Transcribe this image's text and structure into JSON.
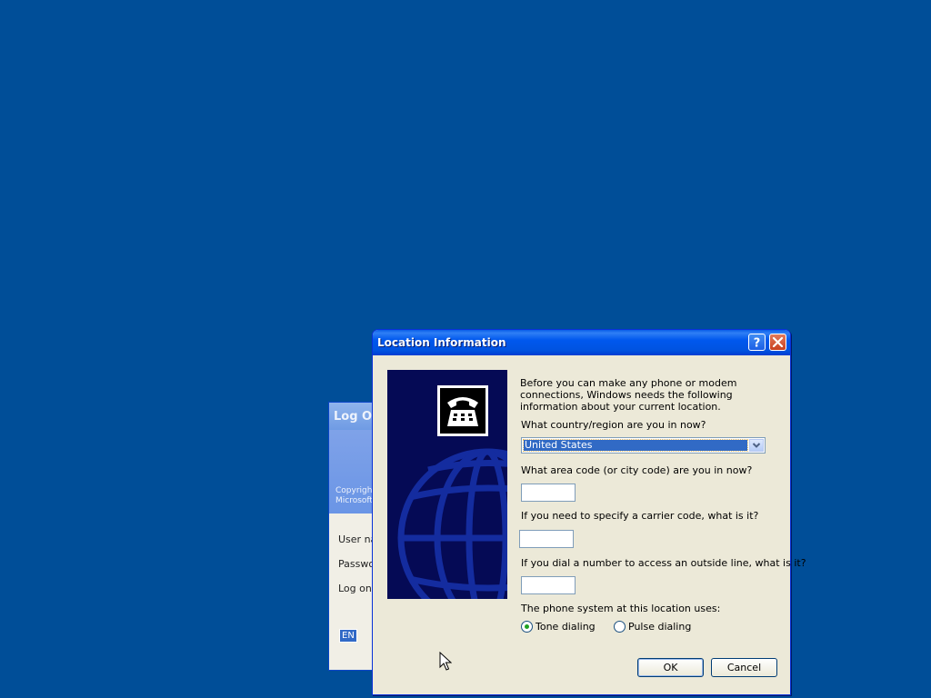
{
  "desktop": {
    "background_color": "#004e98"
  },
  "logon_window": {
    "title": "Log On",
    "copyright_lines": [
      "Copyright",
      "Microsoft C"
    ],
    "labels": [
      "User na",
      "Passwo",
      "Log on t"
    ],
    "language_indicator": "EN"
  },
  "dialog": {
    "title": "Location Information",
    "help_button_icon": "question-mark-icon",
    "close_button_icon": "close-icon",
    "intro_text": "Before you can make any phone or modem connections, Windows needs the following information about your current location.",
    "country_question": "What country/region are you in now?",
    "country_value": "United States",
    "area_code_question": "What area code (or city code) are you in now?",
    "area_code_value": "",
    "carrier_code_question": "If you need to specify a carrier code, what is it?",
    "carrier_code_value": "",
    "outside_line_question": "If you dial a number to access an outside line, what is it?",
    "outside_line_value": "",
    "phone_system_label": "The phone system at this location uses:",
    "tone_dialing_label": "Tone dialing",
    "pulse_dialing_label": "Pulse dialing",
    "selected_dialing": "Tone dialing",
    "ok_label": "OK",
    "cancel_label": "Cancel"
  }
}
